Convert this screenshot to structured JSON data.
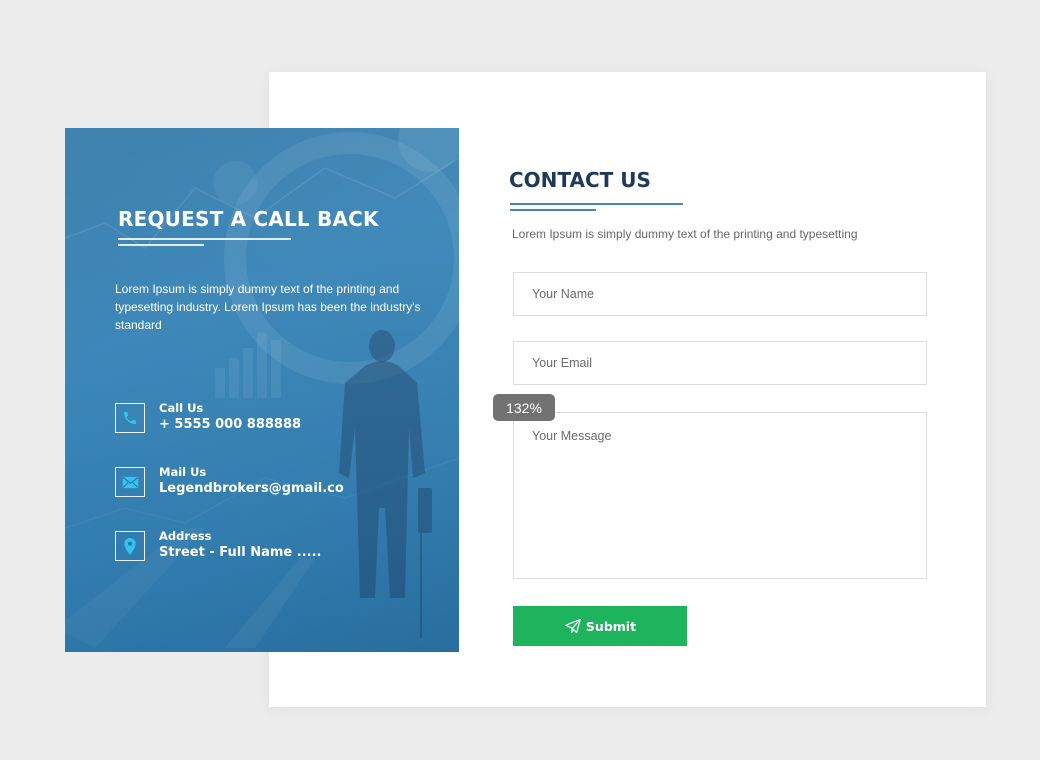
{
  "callback_panel": {
    "title": "REQUEST A CALL BACK",
    "description": "Lorem Ipsum is simply dummy text of the printing and typesetting industry. Lorem Ipsum has been the industry's standard",
    "contacts": [
      {
        "icon": "phone-icon",
        "label": "Call Us",
        "value": "+ 5555 000 888888"
      },
      {
        "icon": "mail-icon",
        "label": "Mail Us",
        "value": "Legendbrokers@gmail.co"
      },
      {
        "icon": "location-pin-icon",
        "label": "Address",
        "value": "Street - Full Name ....."
      }
    ]
  },
  "contact_form": {
    "title": "CONTACT US",
    "description": "Lorem Ipsum is simply dummy text of the printing and typesetting",
    "name_placeholder": "Your Name",
    "email_placeholder": "Your Email",
    "message_placeholder": "Your Message",
    "submit_label": "Submit",
    "submit_icon": "paper-plane-icon"
  },
  "zoom_indicator": "132%",
  "colors": {
    "background": "#ececed",
    "panel_blue": "#2a77ab",
    "heading_navy": "#1e3a5a",
    "submit_green": "#1db45d",
    "underline_blue": "#4a84b5"
  }
}
